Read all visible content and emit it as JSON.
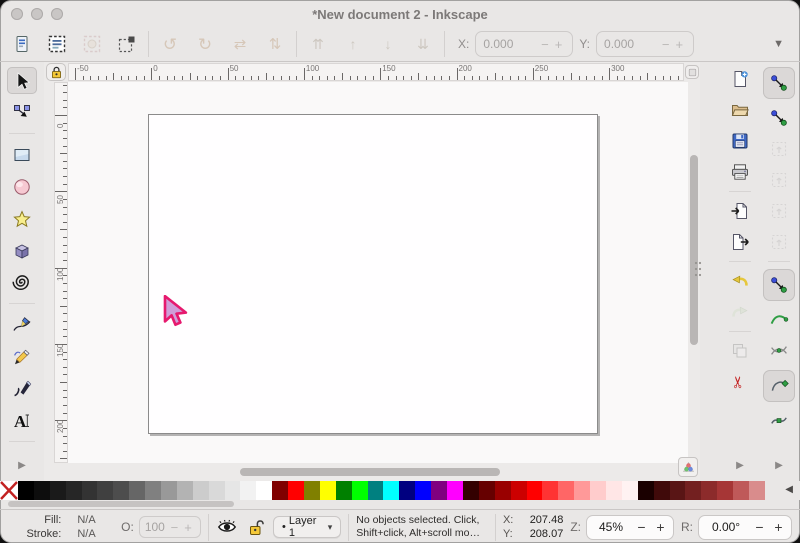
{
  "window": {
    "title": "*New document 2 - Inkscape"
  },
  "glyphs": {
    "expand": "▶",
    "palette_left": "◀",
    "overflow": "▼",
    "dropdown": "▾",
    "minus": "−",
    "plus": "+"
  },
  "toolbar": {
    "select_group": [
      {
        "name": "select-all",
        "icon": "seldoc"
      },
      {
        "name": "select-all-layers",
        "icon": "selectall"
      },
      {
        "name": "deselect",
        "icon": "deselect",
        "disabled": true
      },
      {
        "name": "selection-bbox",
        "icon": "bbox"
      }
    ],
    "transform_group": [
      {
        "name": "rotate-ccw",
        "icon": "rotccw",
        "disabled": true
      },
      {
        "name": "rotate-cw",
        "icon": "rotcw",
        "disabled": true
      },
      {
        "name": "flip-horizontal",
        "icon": "fliph",
        "disabled": true
      },
      {
        "name": "flip-vertical",
        "icon": "flipv",
        "disabled": true
      }
    ],
    "order_group": [
      {
        "name": "raise-to-top",
        "icon": "totop",
        "disabled": true
      },
      {
        "name": "raise",
        "icon": "raise",
        "disabled": true
      },
      {
        "name": "lower",
        "icon": "lower",
        "disabled": true
      },
      {
        "name": "lower-to-bottom",
        "icon": "tobottom",
        "disabled": true
      }
    ],
    "x_label": "X:",
    "x_value": "0.000",
    "y_label": "Y:",
    "y_value": "0.000"
  },
  "toolbox": {
    "tools": [
      {
        "name": "selector-tool",
        "icon": "select",
        "selected": true
      },
      {
        "name": "node-tool",
        "icon": "node"
      },
      {
        "sep": true
      },
      {
        "name": "rectangle-tool",
        "icon": "rect"
      },
      {
        "name": "ellipse-tool",
        "icon": "ellipse"
      },
      {
        "name": "star-tool",
        "icon": "star"
      },
      {
        "name": "box3d-tool",
        "icon": "box3d"
      },
      {
        "name": "spiral-tool",
        "icon": "spiral"
      },
      {
        "sep": true
      },
      {
        "name": "pen-tool",
        "icon": "pen"
      },
      {
        "name": "pencil-tool",
        "icon": "pencil"
      },
      {
        "name": "calligraphy-tool",
        "icon": "calligraphy"
      },
      {
        "name": "text-tool",
        "icon": "text"
      },
      {
        "sep": true
      }
    ]
  },
  "rulers": {
    "h_labels": [
      "-50",
      "0",
      "50",
      "100",
      "150",
      "200",
      "250",
      "300"
    ],
    "v_labels": [
      "0",
      "50",
      "100",
      "150",
      "200"
    ]
  },
  "canvas": {
    "cursor": {
      "fill": "#cf9ed8",
      "stroke": "#e6196e"
    }
  },
  "commands_bar": [
    {
      "name": "new-document",
      "icon": "newdoc"
    },
    {
      "name": "open-document",
      "icon": "open"
    },
    {
      "name": "save-document",
      "icon": "save"
    },
    {
      "name": "print-document",
      "icon": "print"
    },
    {
      "sep": true
    },
    {
      "name": "import-image",
      "icon": "importi"
    },
    {
      "name": "export-image",
      "icon": "exporti"
    },
    {
      "sep": true
    },
    {
      "name": "undo",
      "icon": "undo"
    },
    {
      "name": "redo",
      "icon": "redo",
      "disabled": true
    },
    {
      "sep": true
    },
    {
      "name": "copy",
      "icon": "copy",
      "disabled": true
    },
    {
      "name": "cut",
      "icon": "cut"
    },
    {
      "expand": true
    }
  ],
  "snap_bar": [
    {
      "name": "snap-enable",
      "icon": "snapmaster",
      "active": true
    },
    {
      "name": "snap-bounding-box",
      "icon": "snapmaster"
    },
    {
      "name": "snap-bbox-edges",
      "icon": "snapfaint",
      "disabled": true
    },
    {
      "name": "snap-bbox-corners",
      "icon": "snapfaint",
      "disabled": true
    },
    {
      "name": "snap-bbox-edge-midpoints",
      "icon": "snapfaint",
      "disabled": true
    },
    {
      "name": "snap-bbox-centers",
      "icon": "snapfaint",
      "disabled": true
    },
    {
      "sep": true
    },
    {
      "name": "snap-nodes",
      "icon": "snapmaster",
      "active": true
    },
    {
      "name": "snap-to-paths",
      "icon": "snappath"
    },
    {
      "name": "snap-path-intersections",
      "icon": "snapintersect"
    },
    {
      "name": "snap-cusp-nodes",
      "icon": "snapcusp",
      "active": true
    },
    {
      "name": "snap-smooth-nodes",
      "icon": "snapsmooth"
    },
    {
      "expand": true
    }
  ],
  "palette": {
    "swatches": [
      "#000000",
      "#0d0d0d",
      "#1a1a1a",
      "#262626",
      "#333333",
      "#404040",
      "#4d4d4d",
      "#666666",
      "#808080",
      "#999999",
      "#b3b3b3",
      "#cccccc",
      "#d9d9d9",
      "#e6e6e6",
      "#f2f2f2",
      "#ffffff",
      "#800000",
      "#ff0000",
      "#808000",
      "#ffff00",
      "#008000",
      "#00ff00",
      "#008080",
      "#00ffff",
      "#000080",
      "#0000ff",
      "#800080",
      "#ff00ff",
      "#330000",
      "#660000",
      "#990000",
      "#cc0000",
      "#ff0000",
      "#ff3333",
      "#ff6666",
      "#ff9999",
      "#ffcccc",
      "#ffe6e6",
      "#fff2f2",
      "#1a0000",
      "#400a0a",
      "#591515",
      "#732020",
      "#8c2b2b",
      "#a63636",
      "#bf5959",
      "#d98c8c"
    ]
  },
  "statusbar": {
    "fill_label": "Fill:",
    "fill_value": "N/A",
    "stroke_label": "Stroke:",
    "stroke_value": "N/A",
    "opacity_label": "O:",
    "opacity_value": "100",
    "layer_bullet": "•",
    "layer_name": "Layer 1",
    "message_line1": "No objects selected. Click,",
    "message_line2": "Shift+click, Alt+scroll mo…",
    "x_label": "X:",
    "x_value": "207.48",
    "y_label": "Y:",
    "y_value": "208.07",
    "zoom_label": "Z:",
    "zoom_value": "45%",
    "rotation_label": "R:",
    "rotation_value": "0.00°"
  }
}
